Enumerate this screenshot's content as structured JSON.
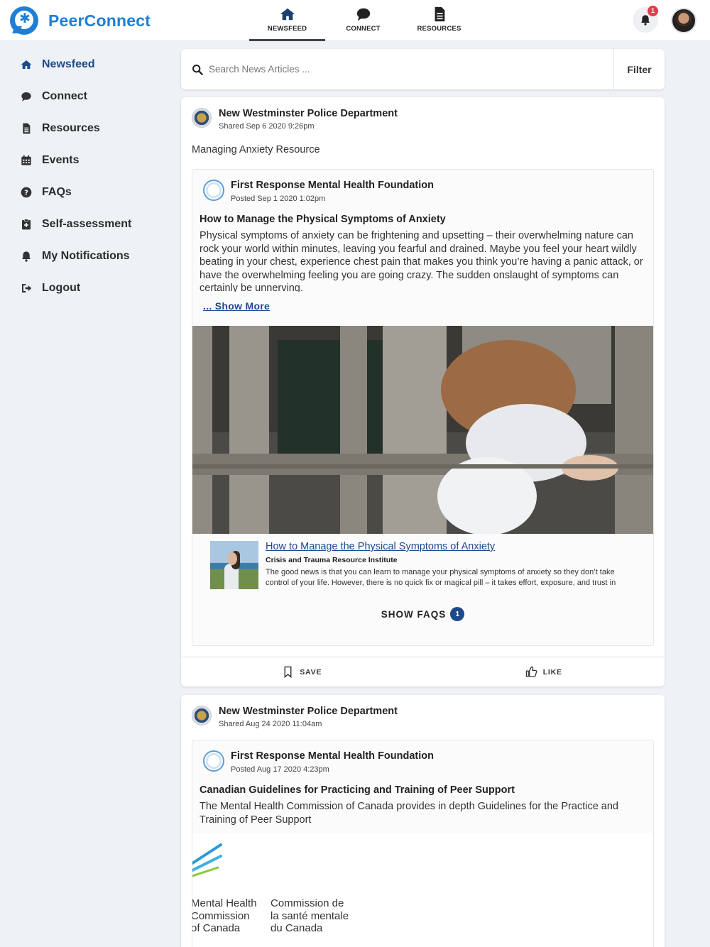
{
  "app": {
    "name": "PeerConnect"
  },
  "topnav": [
    {
      "label": "NEWSFEED",
      "icon": "home-icon",
      "active": true
    },
    {
      "label": "CONNECT",
      "icon": "chat-icon",
      "active": false
    },
    {
      "label": "RESOURCES",
      "icon": "document-icon",
      "active": false
    }
  ],
  "notifications": {
    "count": "1"
  },
  "sidebar": {
    "items": [
      {
        "label": "Newsfeed",
        "icon": "home-icon",
        "active": true
      },
      {
        "label": "Connect",
        "icon": "chat-icon"
      },
      {
        "label": "Resources",
        "icon": "document-icon"
      },
      {
        "label": "Events",
        "icon": "calendar-icon"
      },
      {
        "label": "FAQs",
        "icon": "question-icon"
      },
      {
        "label": "Self-assessment",
        "icon": "clipboard-icon"
      },
      {
        "label": "My Notifications",
        "icon": "bell-icon"
      },
      {
        "label": "Logout",
        "icon": "logout-icon"
      }
    ]
  },
  "search": {
    "placeholder": "Search News Articles ...",
    "filter_label": "Filter"
  },
  "posts": [
    {
      "author": "New Westminster Police Department",
      "date": "Shared Sep 6 2020 9:26pm",
      "caption": "Managing Anxiety Resource",
      "shared": {
        "author": "First Response Mental Health Foundation",
        "date": "Posted Sep 1 2020 1:02pm",
        "title": "How to Manage the Physical Symptoms of Anxiety",
        "body": "Physical symptoms of anxiety can be frightening and upsetting – their overwhelming nature can rock your world within minutes, leaving you fearful and drained. Maybe you feel your heart wildly beating in your chest, experience chest pain that makes you think you’re having a panic attack, or have the overwhelming feeling you are going crazy. The sudden onslaught of symptoms can certainly be unnerving.",
        "show_more": "... Show More",
        "link": {
          "title": "How to Manage the Physical Symptoms of Anxiety",
          "source": "Crisis and Trauma Resource Institute",
          "description": "The good news is that you can learn to manage your physical symptoms of anxiety so they don’t take control of your life. However, there is no quick fix or magical pill – it takes effort, exposure, and trust in"
        },
        "faqs_label": "SHOW FAQS",
        "faqs_count": "1"
      },
      "actions": {
        "save": "SAVE",
        "like": "LIKE"
      }
    },
    {
      "author": "New Westminster Police Department",
      "date": "Shared Aug 24 2020 11:04am",
      "shared": {
        "author": "First Response Mental Health Foundation",
        "date": "Posted Aug 17 2020 4:23pm",
        "title": "Canadian Guidelines for Practicing and Training of Peer Support",
        "body": "The Mental Health Commission of Canada provides in depth Guidelines for the Practice and Training of Peer Support",
        "logo_en": "Mental Health\nCommission\nof Canada",
        "logo_fr": "Commission de\nla santé mentale\ndu Canada"
      }
    }
  ]
}
